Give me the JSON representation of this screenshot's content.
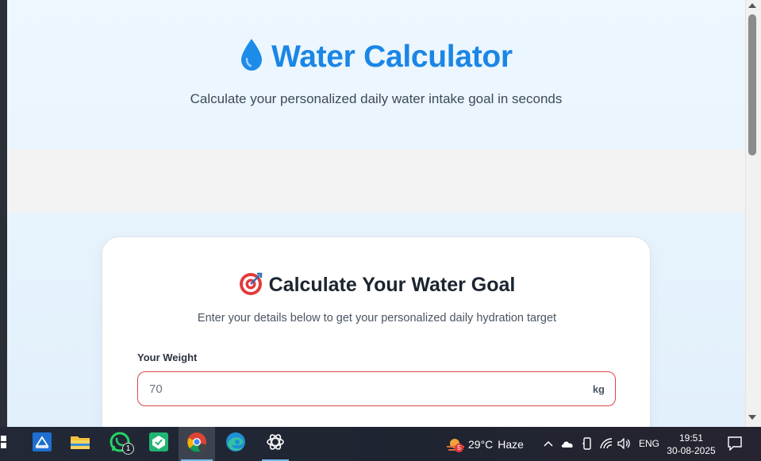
{
  "hero": {
    "title": "Water Calculator",
    "subtitle": "Calculate your personalized daily water intake goal in seconds",
    "icon": "water-drop-icon"
  },
  "card": {
    "title": "Calculate Your Water Goal",
    "subtitle": "Enter your details below to get your personalized daily hydration target",
    "icon": "target-icon",
    "weight_label": "Your Weight",
    "weight_placeholder": "70",
    "weight_unit": "kg"
  },
  "taskbar": {
    "apps": [
      {
        "name": "start-icon"
      },
      {
        "name": "app-icon"
      },
      {
        "name": "file-explorer-icon"
      },
      {
        "name": "whatsapp-icon",
        "badge": "1"
      },
      {
        "name": "app-icon"
      },
      {
        "name": "chrome-icon"
      },
      {
        "name": "edge-icon"
      },
      {
        "name": "chatgpt-icon"
      }
    ],
    "weather_badge": "5",
    "temperature": "29°C",
    "weather_condition": "Haze",
    "language": "ENG",
    "time": "19:51",
    "date": "30-08-2025"
  },
  "colors": {
    "accent": "#1a86e6",
    "input_border_error": "#d9474b",
    "taskbar_bg": "#1f2431"
  }
}
